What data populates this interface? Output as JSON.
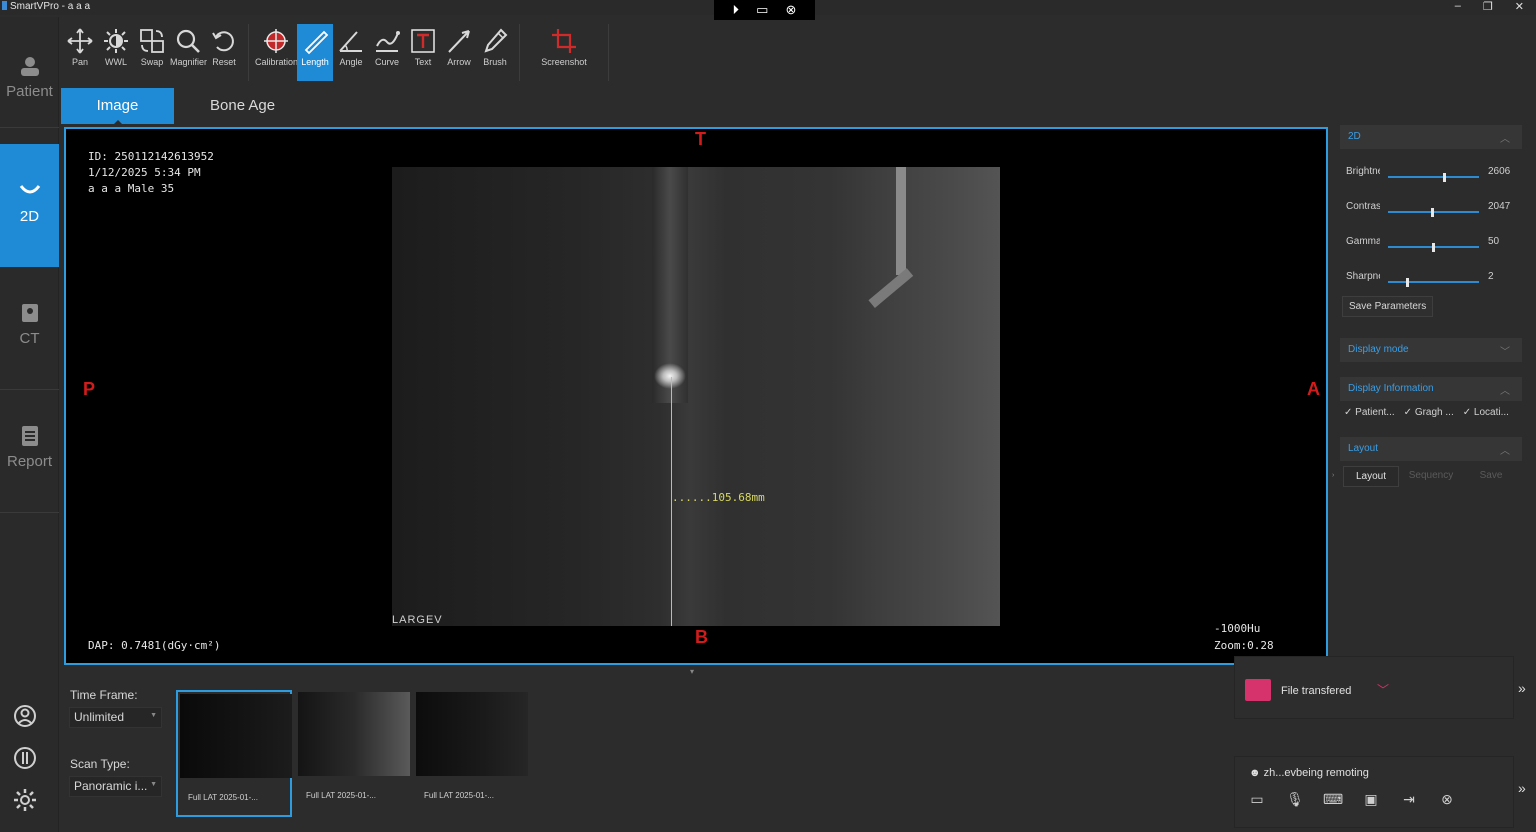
{
  "window": {
    "title": "SmartVPro - a a a",
    "controls": [
      "–",
      "❐",
      "✕"
    ]
  },
  "remote_bar": {
    "icons": [
      "⏵",
      "▭",
      "⊗"
    ]
  },
  "nav": {
    "items": [
      {
        "label": "Patient"
      },
      {
        "label": "2D"
      },
      {
        "label": "CT"
      },
      {
        "label": "Report"
      }
    ]
  },
  "toolbar": {
    "tools": [
      {
        "label": "Pan",
        "icon": "pan-icon"
      },
      {
        "label": "WWL",
        "icon": "wwl-icon"
      },
      {
        "label": "Swap",
        "icon": "swap-icon"
      },
      {
        "label": "Magnifier",
        "icon": "magnifier-icon"
      },
      {
        "label": "Reset",
        "icon": "reset-icon"
      },
      {
        "label": "Calibration",
        "icon": "calibration-icon"
      },
      {
        "label": "Length",
        "icon": "length-icon"
      },
      {
        "label": "Angle",
        "icon": "angle-icon"
      },
      {
        "label": "Curve",
        "icon": "curve-icon"
      },
      {
        "label": "Text",
        "icon": "text-icon"
      },
      {
        "label": "Arrow",
        "icon": "arrow-icon"
      },
      {
        "label": "Brush",
        "icon": "brush-icon"
      },
      {
        "label": "Screenshot",
        "icon": "screenshot-icon"
      }
    ],
    "active": "Length"
  },
  "tabs": [
    {
      "label": "Image"
    },
    {
      "label": "Bone Age"
    }
  ],
  "viewer": {
    "id_line": "ID: 250112142613952",
    "date_line": "1/12/2025 5:34 PM",
    "patient_line": "a a a Male 35",
    "dap": "DAP: 0.7481(dGy·cm²)",
    "hu": "-1000Hu",
    "zoom": "Zoom:0.28",
    "orient": {
      "top": "T",
      "bottom": "B",
      "left": "P",
      "right": "A"
    },
    "measurement": "105.68mm",
    "logo": "LARGEV"
  },
  "right_panel": {
    "section_2d": "2D",
    "sliders": [
      {
        "label": "Brightness",
        "value": "2606",
        "level": 0.63
      },
      {
        "label": "Contrast",
        "value": "2047",
        "level": 0.49
      },
      {
        "label": "Gamma",
        "value": "50",
        "level": 0.5
      },
      {
        "label": "Sharpness",
        "value": "2",
        "level": 0.2
      }
    ],
    "save_params": "Save Parameters",
    "display_mode": "Display mode",
    "display_info": "Display Information",
    "checks": [
      "Patient...",
      "Gragh ...",
      "Locati..."
    ],
    "layout_head": "Layout",
    "layout_buttons": [
      "Layout",
      "Sequency",
      "Save"
    ]
  },
  "bottom": {
    "time_frame_label": "Time Frame:",
    "time_frame_value": "Unlimited",
    "scan_type_label": "Scan Type:",
    "scan_type_value": "Panoramic i...",
    "thumbnails": [
      {
        "caption": "Full LAT 2025-01-..."
      },
      {
        "caption": "Full LAT 2025-01-..."
      },
      {
        "caption": "Full LAT 2025-01-..."
      }
    ]
  },
  "notification": {
    "text": "File transfered"
  },
  "remote_panel": {
    "text": "zh...evbeing remoting"
  },
  "colors": {
    "accent": "#1f8bd6",
    "orient": "#d21c1c",
    "measure": "#d8d860"
  }
}
